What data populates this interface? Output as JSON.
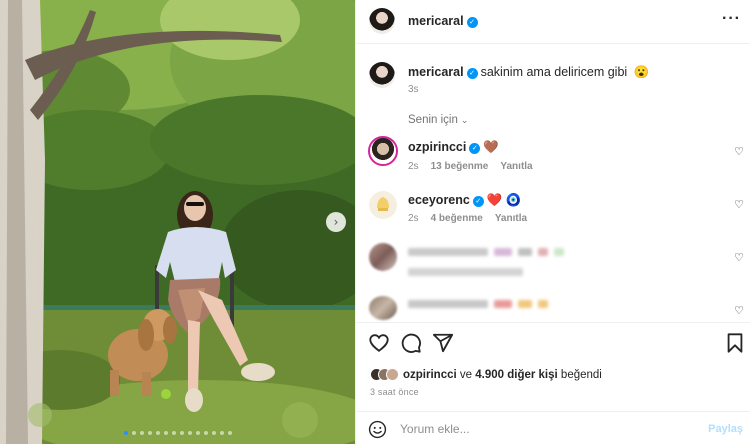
{
  "post": {
    "author": "mericaral",
    "caption": "sakinim ama deliricem gibi",
    "caption_emoji": "😮",
    "caption_time": "3s",
    "slide_count": 14,
    "active_slide": 1
  },
  "comments_section": {
    "for_you_label": "Senin için",
    "for_you_chevron": "⌄"
  },
  "comments": [
    {
      "user": "ozpirincci",
      "verified": true,
      "emoji": "🤎",
      "time": "2s",
      "likes": "13 beğenme",
      "reply": "Yanıtla"
    },
    {
      "user": "eceyorenc",
      "verified": true,
      "emoji": "❤️ 🧿",
      "time": "2s",
      "likes": "4 beğenme",
      "reply": "Yanıtla"
    }
  ],
  "blurred_comments": [
    {
      "colors": [
        "#c9c9c9",
        "#d7b8d8",
        "#bfbfbf",
        "#e2b0b0",
        "#cde7c9"
      ]
    },
    {
      "colors": [
        "#c7c7c7",
        "#e89a9a",
        "#f2c77b",
        "#f2c77b"
      ]
    }
  ],
  "footer": {
    "liked_by_user": "ozpirincci",
    "liked_connector": "ve",
    "liked_others": "4.900 diğer kişi",
    "liked_suffix": "beğendi",
    "time_ago": "3 saat önce",
    "comment_placeholder": "Yorum ekle...",
    "post_label": "Paylaş"
  },
  "icons": {
    "more": "more-horizontal-icon",
    "like": "heart-outline-icon",
    "comment": "comment-bubble-icon",
    "share": "send-paper-plane-icon",
    "save": "bookmark-icon",
    "emoji": "smiley-icon",
    "next": "chevron-right-icon"
  },
  "colors": {
    "verified": "#0095f6",
    "active_dot": "#2f8cff",
    "post_button_disabled": "#b2dffc",
    "muted_text": "#8e8e8e"
  }
}
